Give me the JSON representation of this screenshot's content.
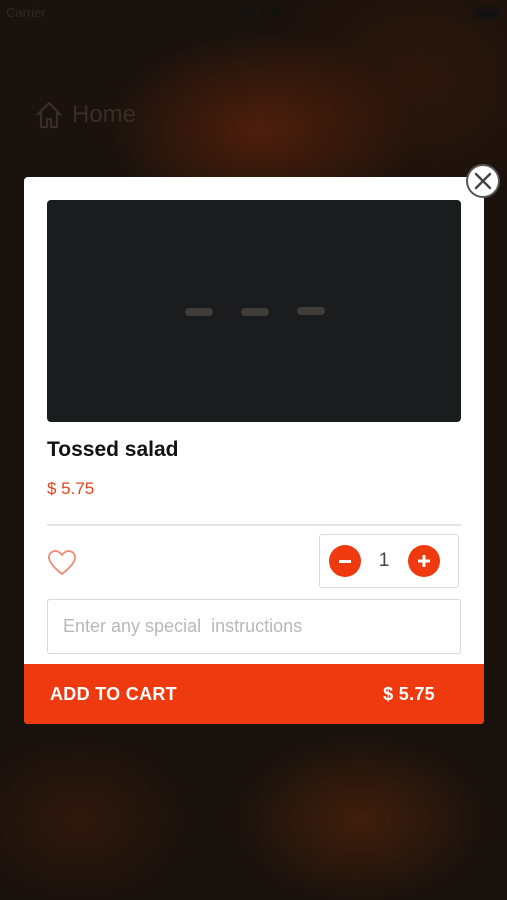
{
  "status_bar": {
    "carrier": "Carrier",
    "time": "2:22 PM"
  },
  "nav": {
    "home_label": "Home"
  },
  "item": {
    "name": "Tossed salad",
    "price": "$ 5.75",
    "quantity": "1",
    "favorite_icon": "heart-outline-icon"
  },
  "instructions": {
    "placeholder": "Enter any special  instructions",
    "value": ""
  },
  "cart": {
    "add_label": "ADD TO CART",
    "total": "$ 5.75"
  },
  "colors": {
    "accent": "#ef3a10",
    "price": "#e5411c"
  }
}
